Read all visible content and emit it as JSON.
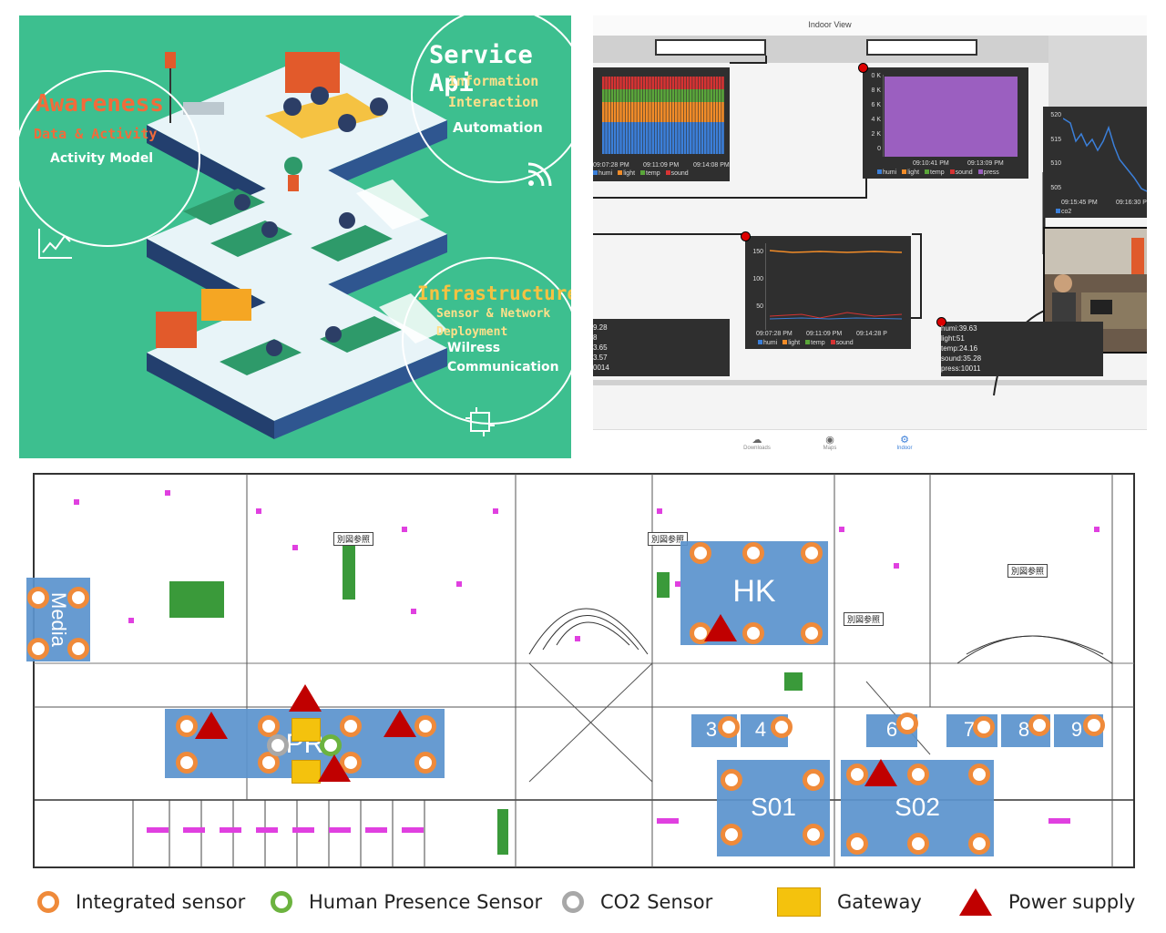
{
  "illustration": {
    "awareness": {
      "title": "Awareness",
      "line1": "Data & Activity",
      "line2": "Activity Model"
    },
    "service": {
      "title": "Service Api",
      "line1": "Information",
      "line2": "Interaction",
      "line3": "Automation"
    },
    "infrastructure": {
      "title": "Infrastructure",
      "line1": "Sensor & Network",
      "line2": "Deployment",
      "line3": "Wilress",
      "line4": "Communication"
    }
  },
  "dashboard": {
    "window_title": "Indoor View",
    "chart1": {
      "x_ticks": [
        "09:07:28 PM",
        "09:11:09 PM",
        "09:14:08 PM"
      ],
      "legend": [
        "humi",
        "light",
        "temp",
        "sound"
      ],
      "colors": [
        "#3b7fd9",
        "#f28c28",
        "#5aa63a",
        "#d63333"
      ]
    },
    "chart2": {
      "y_ticks": [
        "0 K",
        "8 K",
        "6 K",
        "4 K",
        "2 K",
        "0"
      ],
      "x_ticks": [
        "09:10:41 PM",
        "09:13:09 PM"
      ],
      "legend": [
        "humi",
        "light",
        "temp",
        "sound",
        "press"
      ],
      "colors": [
        "#3b7fd9",
        "#f28c28",
        "#5aa63a",
        "#d63333",
        "#9b5fc0"
      ]
    },
    "chart3": {
      "y_ticks": [
        "520",
        "515",
        "510",
        "505"
      ],
      "x_ticks": [
        "09:15:45 PM",
        "09:16:30 P"
      ],
      "legend": [
        "co2"
      ],
      "colors": [
        "#3b7fd9"
      ]
    },
    "chart4": {
      "y_ticks": [
        "150",
        "100",
        "50"
      ],
      "x_ticks": [
        "09:07:28 PM",
        "09:11:09 PM",
        "09:14:28 P"
      ],
      "legend": [
        "humi",
        "light",
        "temp",
        "sound"
      ],
      "colors": [
        "#3b7fd9",
        "#f28c28",
        "#5aa63a",
        "#d63333"
      ]
    },
    "partial_readings": [
      "9.28",
      "8",
      "3.65",
      "3.57",
      "0014"
    ],
    "readings": [
      "humi:39.63",
      "light:51",
      "temp:24.16",
      "sound:35.28",
      "press:10011"
    ],
    "nav": [
      {
        "label": "Downloads",
        "icon": "download-icon"
      },
      {
        "label": "Maps",
        "icon": "compass-icon"
      },
      {
        "label": "Indoor",
        "icon": "gear-icon"
      }
    ],
    "accent": "#3b7fd9"
  },
  "floor_plan": {
    "rooms": [
      "Media",
      "HK",
      "PR",
      "3",
      "4",
      "6",
      "7",
      "8",
      "9",
      "S01",
      "S02"
    ],
    "tags": [
      "別図参照",
      "別図参照",
      "別図参照",
      "別図参照"
    ],
    "room_color": "#5b93cd"
  },
  "legend": {
    "integrated_sensor": "Integrated sensor",
    "human_presence_sensor": "Human Presence Sensor",
    "co2_sensor": "CO2 Sensor",
    "gateway": "Gateway",
    "power_supply": "Power supply",
    "colors": {
      "integrated": "#ef8a3a",
      "presence": "#6cb33f",
      "co2": "#a8a8a8",
      "gateway": "#f4c20d",
      "power": "#c00000"
    }
  }
}
